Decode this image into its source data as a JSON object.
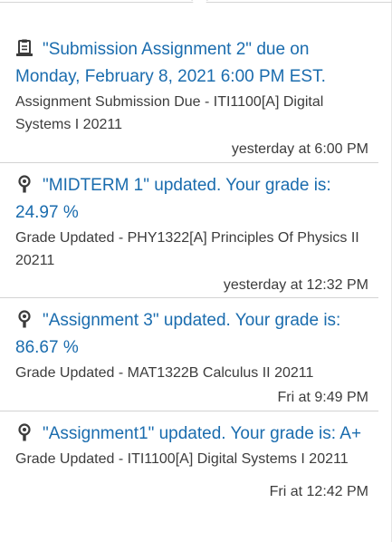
{
  "notifications": [
    {
      "icon": "assignment-submission-icon",
      "title": "\"Submission Assignment 2\" due on Monday, February 8, 2021 6:00 PM EST.",
      "description": "Assignment Submission Due - ITI1100[A] Digital Systems I 20211",
      "time": "yesterday at 6:00 PM"
    },
    {
      "icon": "grade-award-icon",
      "title": "\"MIDTERM 1\" updated. Your grade is: 24.97 %",
      "description": "Grade Updated - PHY1322[A] Principles Of Physics II 20211",
      "time": "yesterday at 12:32 PM"
    },
    {
      "icon": "grade-award-icon",
      "title": "\"Assignment 3\" updated. Your grade is: 86.67 %",
      "description": "Grade Updated - MAT1322B Calculus II 20211",
      "time": "Fri at 9:49 PM"
    },
    {
      "icon": "grade-award-icon",
      "title": "\"Assignment1\" updated. Your grade is: A+",
      "description": "Grade Updated - ITI1100[A] Digital Systems I 20211",
      "time": "Fri at 12:42 PM"
    }
  ]
}
